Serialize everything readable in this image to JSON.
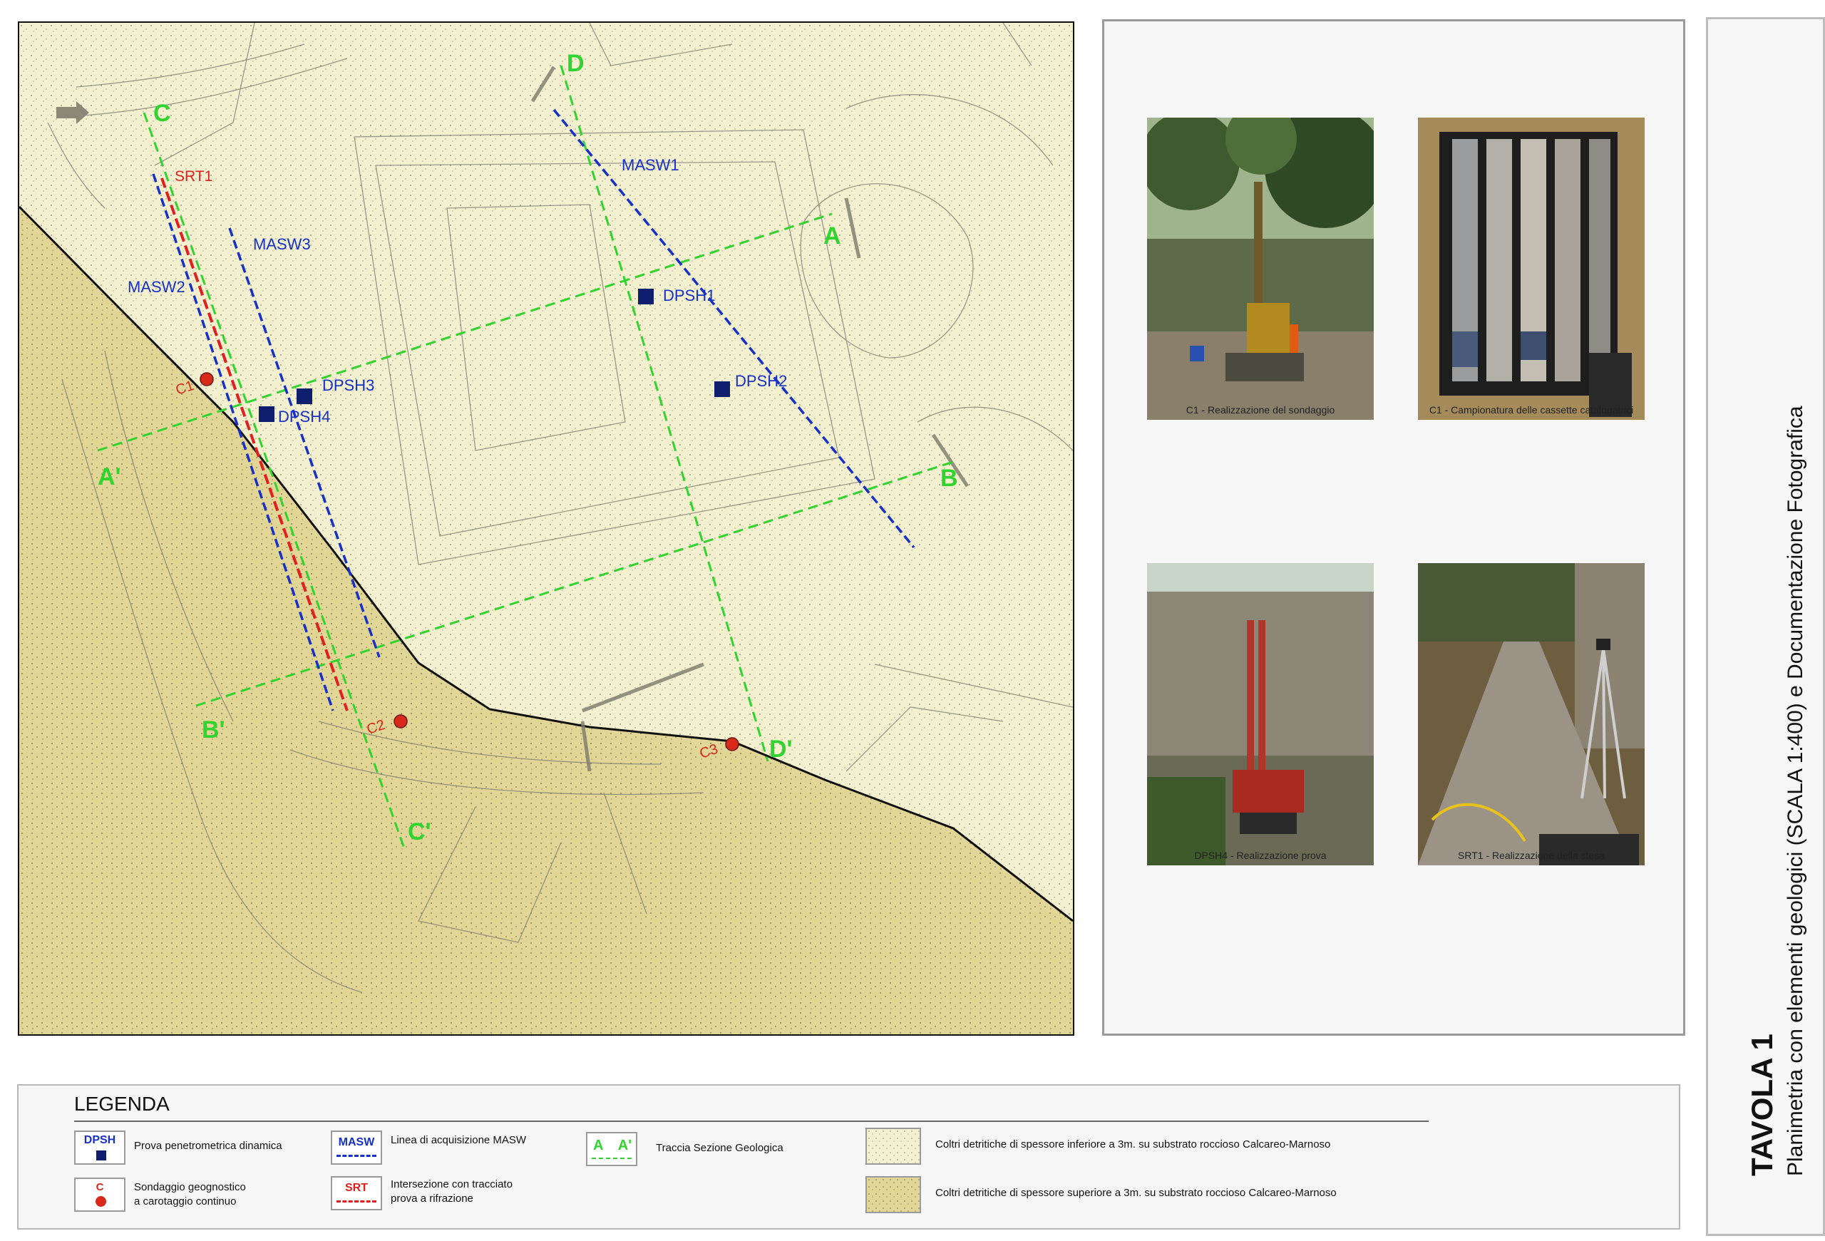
{
  "map": {
    "section_labels": [
      "A",
      "A'",
      "B",
      "B'",
      "C",
      "C'",
      "D",
      "D'"
    ],
    "line_labels": {
      "masw1": "MASW1",
      "masw2": "MASW2",
      "masw3": "MASW3",
      "srt1": "SRT1"
    },
    "dpsh_labels": [
      "DPSH1",
      "DPSH2",
      "DPSH3",
      "DPSH4"
    ],
    "borehole_labels": [
      "C1",
      "C2",
      "C3"
    ],
    "colors": {
      "thin_cover": "#f3f0cf",
      "thick_cover": "#e2d696",
      "masw": "#1630c8",
      "srt": "#e01f1f",
      "section": "#31d42f",
      "dpsh": "#101e6e",
      "borehole": "#d8291b"
    }
  },
  "photos": [
    {
      "caption": "C1 - Realizzazione del sondaggio"
    },
    {
      "caption": "C1 - Campionatura delle cassette catalogatrici"
    },
    {
      "caption": "DPSH4 - Realizzazione prova"
    },
    {
      "caption": "SRT1 - Realizzazione della stesa"
    }
  ],
  "legend": {
    "title": "LEGENDA",
    "items": {
      "dpsh_symbol": "DPSH",
      "dpsh_text": "Prova penetrometrica dinamica",
      "c_symbol": "C",
      "c_text_line1": "Sondaggio geognostico",
      "c_text_line2": "a carotaggio continuo",
      "masw_symbol": "MASW",
      "masw_text": "Linea di acquisizione MASW",
      "srt_symbol": "SRT",
      "srt_text_line1": "Intersezione con tracciato",
      "srt_text_line2": "prova a rifrazione",
      "section_a": "A",
      "section_a_prime": "A'",
      "section_text": "Traccia Sezione Geologica",
      "thin_text": "Coltri detritiche di spessore inferiore a 3m. su substrato roccioso Calcareo-Marnoso",
      "thick_text": "Coltri detritiche di spessore superiore a 3m. su substrato roccioso Calcareo-Marnoso"
    }
  },
  "title_block": {
    "tavola": "TAVOLA 1",
    "subtitle": "Planimetria con elementi geologici (SCALA 1:400) e Documentazione Fotografica"
  }
}
